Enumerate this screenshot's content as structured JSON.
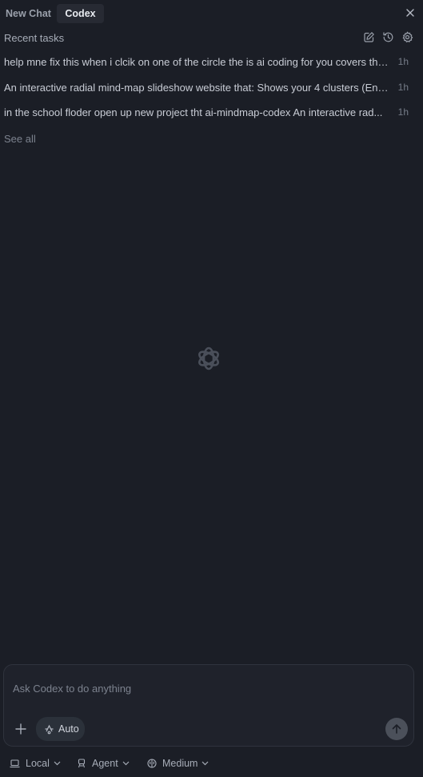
{
  "tabs": [
    {
      "label": "New Chat",
      "active": false
    },
    {
      "label": "Codex",
      "active": true
    }
  ],
  "recent": {
    "title": "Recent tasks",
    "tasks": [
      {
        "text": "help mne fix this when i clcik on one of the circle the is ai coding for you covers the...",
        "time": "1h"
      },
      {
        "text": "An interactive radial mind-map slideshow website that: Shows your 4 clusters (Env...",
        "time": "1h"
      },
      {
        "text": "in the school floder open up new project tht ai-mindmap-codex An interactive rad...",
        "time": "1h"
      }
    ],
    "see_all": "See all"
  },
  "composer": {
    "placeholder": "Ask Codex to do anything",
    "value": "",
    "mode_label": "Auto"
  },
  "footer": {
    "environment": "Local",
    "agent": "Agent",
    "reasoning": "Medium"
  },
  "colors": {
    "background": "#1b1e26",
    "active_tab": "#272a33",
    "composer_bg": "#1f222b",
    "chip_bg": "#2b313a",
    "send_bg": "#4b505a"
  }
}
